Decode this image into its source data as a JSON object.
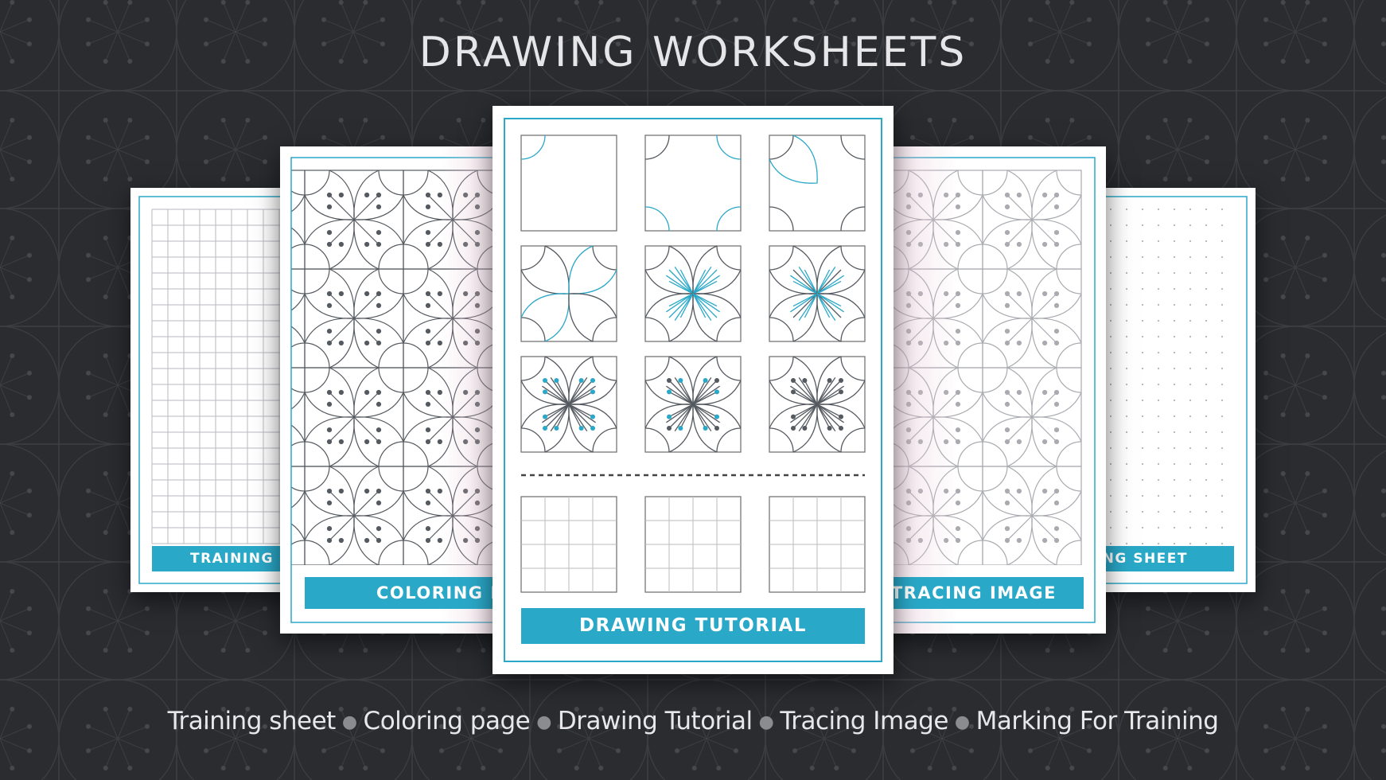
{
  "title": "DRAWING WORKSHEETS",
  "worksheets": [
    {
      "label": "TRAINING SHEET"
    },
    {
      "label": "COLORING PAGE"
    },
    {
      "label": "DRAWING TUTORIAL"
    },
    {
      "label": "TRACING IMAGE"
    },
    {
      "label": "MARKING SHEET"
    }
  ],
  "features": [
    "Training sheet",
    "Coloring page",
    "Drawing Tutorial",
    "Tracing Image",
    "Marking For Training"
  ],
  "colors": {
    "background": "#2a2c30",
    "accent": "#2aa8c8",
    "line": "#555a60",
    "tracing": "#a9abb0"
  }
}
